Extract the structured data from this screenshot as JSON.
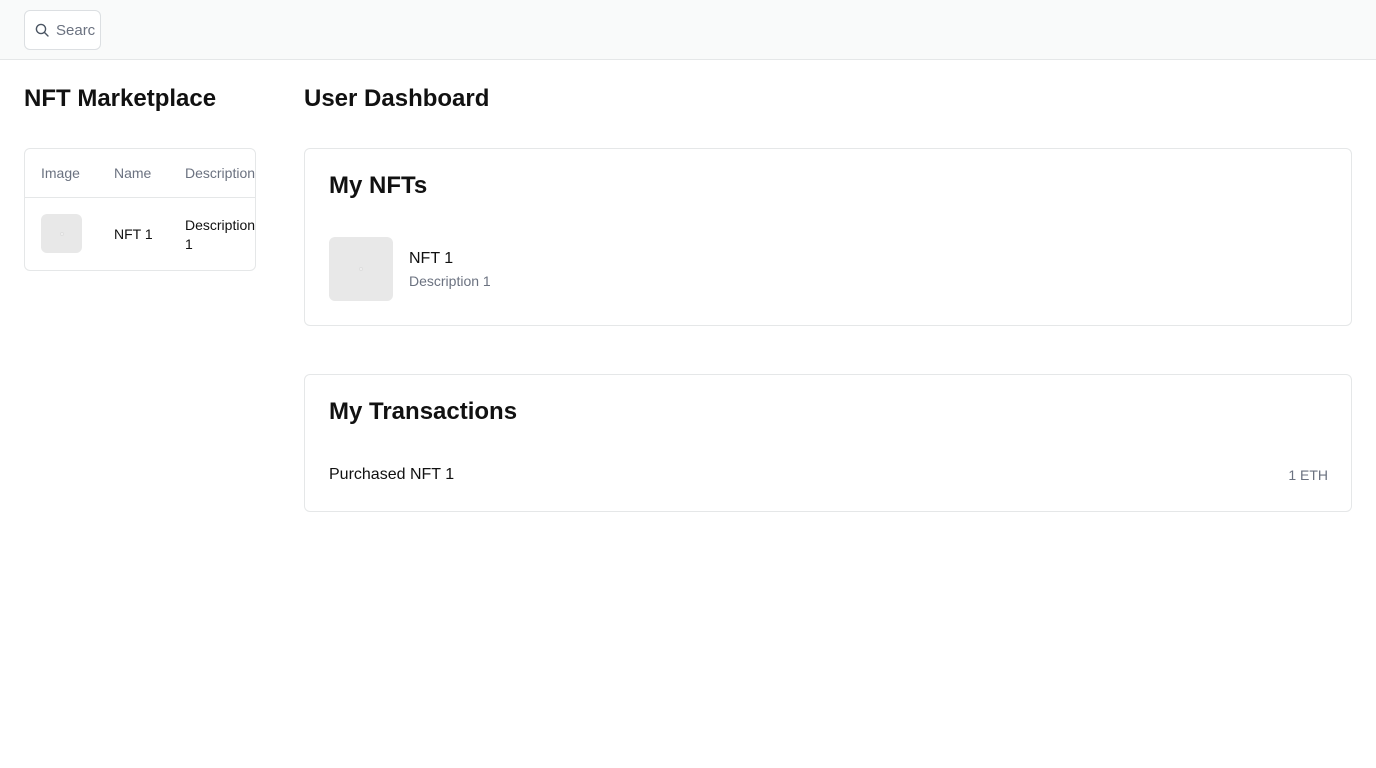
{
  "search": {
    "placeholder": "Search"
  },
  "marketplace": {
    "title": "NFT Marketplace",
    "columns": [
      "Image",
      "Name",
      "Description"
    ],
    "rows": [
      {
        "name": "NFT 1",
        "description": "Description 1"
      }
    ]
  },
  "dashboard": {
    "title": "User Dashboard",
    "my_nfts": {
      "title": "My NFTs",
      "items": [
        {
          "name": "NFT 1",
          "description": "Description 1"
        }
      ]
    },
    "my_transactions": {
      "title": "My Transactions",
      "items": [
        {
          "label": "Purchased NFT 1",
          "amount": "1 ETH"
        }
      ]
    }
  }
}
